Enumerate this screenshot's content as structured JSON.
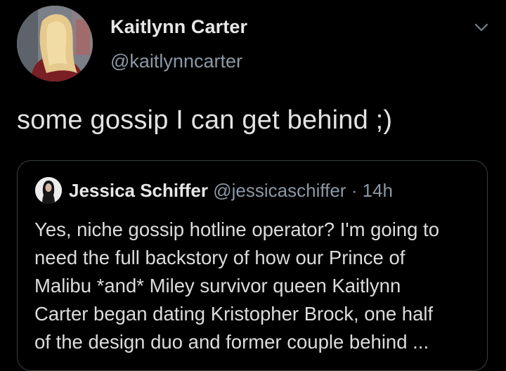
{
  "tweet": {
    "author_name": "Kaitlynn Carter",
    "author_handle": "@kaitlynncarter",
    "text": "some gossip I can get behind ;)",
    "menu_icon": "chevron-down-icon"
  },
  "quote": {
    "author_name": "Jessica Schiffer",
    "author_handle": "@jessicaschiffer",
    "separator": "·",
    "time": "14h",
    "lines": [
      "Yes, niche gossip hotline operator? I'm going to",
      "need the full backstory of how our Prince of",
      "Malibu *and* Miley survivor queen Kaitlynn",
      "Carter began dating Kristopher Brock, one half",
      "of the design duo and former couple behind ..."
    ]
  },
  "colors": {
    "background": "#000000",
    "primary_text": "#e7e7e7",
    "secondary_text": "#8b98a5",
    "border": "#3a3f44"
  }
}
